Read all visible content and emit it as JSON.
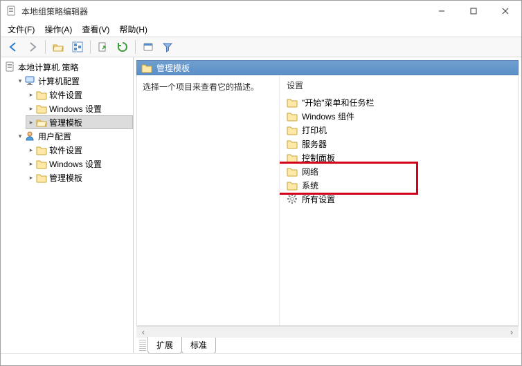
{
  "window": {
    "title": "本地组策略编辑器",
    "controls": {
      "min": "minimize",
      "max": "maximize",
      "close": "close"
    }
  },
  "menu": {
    "file": "文件(F)",
    "action": "操作(A)",
    "view": "查看(V)",
    "help": "帮助(H)"
  },
  "toolbar_icons": [
    "nav-back",
    "nav-forward",
    "sep",
    "folder-up",
    "tree-toggle",
    "sep",
    "export-list",
    "refresh",
    "sep",
    "properties",
    "filter"
  ],
  "tree": {
    "root": {
      "label": "本地计算机 策略"
    },
    "computer": {
      "label": "计算机配置",
      "children": {
        "software": "软件设置",
        "windows": "Windows 设置",
        "templates": "管理模板"
      }
    },
    "user": {
      "label": "用户配置",
      "children": {
        "software": "软件设置",
        "windows": "Windows 设置",
        "templates": "管理模板"
      }
    }
  },
  "right": {
    "path_label": "管理模板",
    "description_prompt": "选择一个项目来查看它的描述。",
    "settings_header": "设置",
    "items": [
      {
        "icon": "folder",
        "label": "\"开始\"菜单和任务栏"
      },
      {
        "icon": "folder",
        "label": "Windows 组件"
      },
      {
        "icon": "folder",
        "label": "打印机"
      },
      {
        "icon": "folder",
        "label": "服务器"
      },
      {
        "icon": "folder",
        "label": "控制面板"
      },
      {
        "icon": "folder",
        "label": "网络"
      },
      {
        "icon": "folder",
        "label": "系统"
      },
      {
        "icon": "settings",
        "label": "所有设置"
      }
    ]
  },
  "tabs": {
    "extended": "扩展",
    "standard": "标准"
  }
}
